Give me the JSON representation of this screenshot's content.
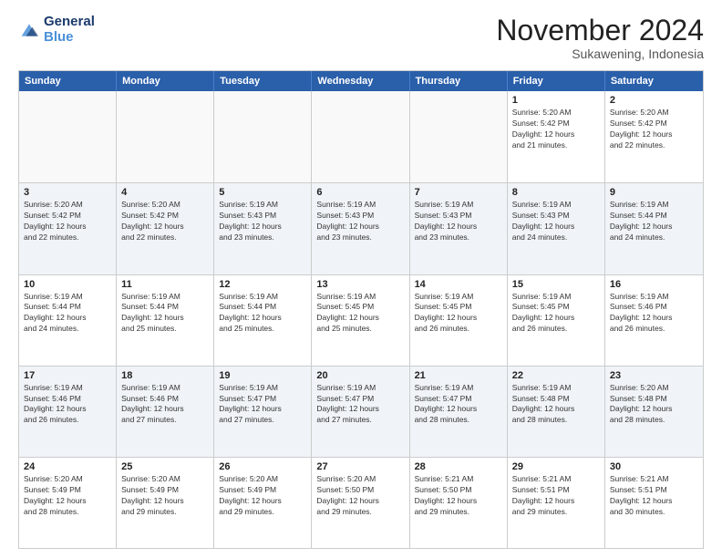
{
  "logo": {
    "general": "General",
    "blue": "Blue"
  },
  "title": "November 2024",
  "subtitle": "Sukawening, Indonesia",
  "header_days": [
    "Sunday",
    "Monday",
    "Tuesday",
    "Wednesday",
    "Thursday",
    "Friday",
    "Saturday"
  ],
  "weeks": [
    [
      {
        "day": "",
        "info": ""
      },
      {
        "day": "",
        "info": ""
      },
      {
        "day": "",
        "info": ""
      },
      {
        "day": "",
        "info": ""
      },
      {
        "day": "",
        "info": ""
      },
      {
        "day": "1",
        "info": "Sunrise: 5:20 AM\nSunset: 5:42 PM\nDaylight: 12 hours\nand 21 minutes."
      },
      {
        "day": "2",
        "info": "Sunrise: 5:20 AM\nSunset: 5:42 PM\nDaylight: 12 hours\nand 22 minutes."
      }
    ],
    [
      {
        "day": "3",
        "info": "Sunrise: 5:20 AM\nSunset: 5:42 PM\nDaylight: 12 hours\nand 22 minutes."
      },
      {
        "day": "4",
        "info": "Sunrise: 5:20 AM\nSunset: 5:42 PM\nDaylight: 12 hours\nand 22 minutes."
      },
      {
        "day": "5",
        "info": "Sunrise: 5:19 AM\nSunset: 5:43 PM\nDaylight: 12 hours\nand 23 minutes."
      },
      {
        "day": "6",
        "info": "Sunrise: 5:19 AM\nSunset: 5:43 PM\nDaylight: 12 hours\nand 23 minutes."
      },
      {
        "day": "7",
        "info": "Sunrise: 5:19 AM\nSunset: 5:43 PM\nDaylight: 12 hours\nand 23 minutes."
      },
      {
        "day": "8",
        "info": "Sunrise: 5:19 AM\nSunset: 5:43 PM\nDaylight: 12 hours\nand 24 minutes."
      },
      {
        "day": "9",
        "info": "Sunrise: 5:19 AM\nSunset: 5:44 PM\nDaylight: 12 hours\nand 24 minutes."
      }
    ],
    [
      {
        "day": "10",
        "info": "Sunrise: 5:19 AM\nSunset: 5:44 PM\nDaylight: 12 hours\nand 24 minutes."
      },
      {
        "day": "11",
        "info": "Sunrise: 5:19 AM\nSunset: 5:44 PM\nDaylight: 12 hours\nand 25 minutes."
      },
      {
        "day": "12",
        "info": "Sunrise: 5:19 AM\nSunset: 5:44 PM\nDaylight: 12 hours\nand 25 minutes."
      },
      {
        "day": "13",
        "info": "Sunrise: 5:19 AM\nSunset: 5:45 PM\nDaylight: 12 hours\nand 25 minutes."
      },
      {
        "day": "14",
        "info": "Sunrise: 5:19 AM\nSunset: 5:45 PM\nDaylight: 12 hours\nand 26 minutes."
      },
      {
        "day": "15",
        "info": "Sunrise: 5:19 AM\nSunset: 5:45 PM\nDaylight: 12 hours\nand 26 minutes."
      },
      {
        "day": "16",
        "info": "Sunrise: 5:19 AM\nSunset: 5:46 PM\nDaylight: 12 hours\nand 26 minutes."
      }
    ],
    [
      {
        "day": "17",
        "info": "Sunrise: 5:19 AM\nSunset: 5:46 PM\nDaylight: 12 hours\nand 26 minutes."
      },
      {
        "day": "18",
        "info": "Sunrise: 5:19 AM\nSunset: 5:46 PM\nDaylight: 12 hours\nand 27 minutes."
      },
      {
        "day": "19",
        "info": "Sunrise: 5:19 AM\nSunset: 5:47 PM\nDaylight: 12 hours\nand 27 minutes."
      },
      {
        "day": "20",
        "info": "Sunrise: 5:19 AM\nSunset: 5:47 PM\nDaylight: 12 hours\nand 27 minutes."
      },
      {
        "day": "21",
        "info": "Sunrise: 5:19 AM\nSunset: 5:47 PM\nDaylight: 12 hours\nand 28 minutes."
      },
      {
        "day": "22",
        "info": "Sunrise: 5:19 AM\nSunset: 5:48 PM\nDaylight: 12 hours\nand 28 minutes."
      },
      {
        "day": "23",
        "info": "Sunrise: 5:20 AM\nSunset: 5:48 PM\nDaylight: 12 hours\nand 28 minutes."
      }
    ],
    [
      {
        "day": "24",
        "info": "Sunrise: 5:20 AM\nSunset: 5:49 PM\nDaylight: 12 hours\nand 28 minutes."
      },
      {
        "day": "25",
        "info": "Sunrise: 5:20 AM\nSunset: 5:49 PM\nDaylight: 12 hours\nand 29 minutes."
      },
      {
        "day": "26",
        "info": "Sunrise: 5:20 AM\nSunset: 5:49 PM\nDaylight: 12 hours\nand 29 minutes."
      },
      {
        "day": "27",
        "info": "Sunrise: 5:20 AM\nSunset: 5:50 PM\nDaylight: 12 hours\nand 29 minutes."
      },
      {
        "day": "28",
        "info": "Sunrise: 5:21 AM\nSunset: 5:50 PM\nDaylight: 12 hours\nand 29 minutes."
      },
      {
        "day": "29",
        "info": "Sunrise: 5:21 AM\nSunset: 5:51 PM\nDaylight: 12 hours\nand 29 minutes."
      },
      {
        "day": "30",
        "info": "Sunrise: 5:21 AM\nSunset: 5:51 PM\nDaylight: 12 hours\nand 30 minutes."
      }
    ]
  ]
}
